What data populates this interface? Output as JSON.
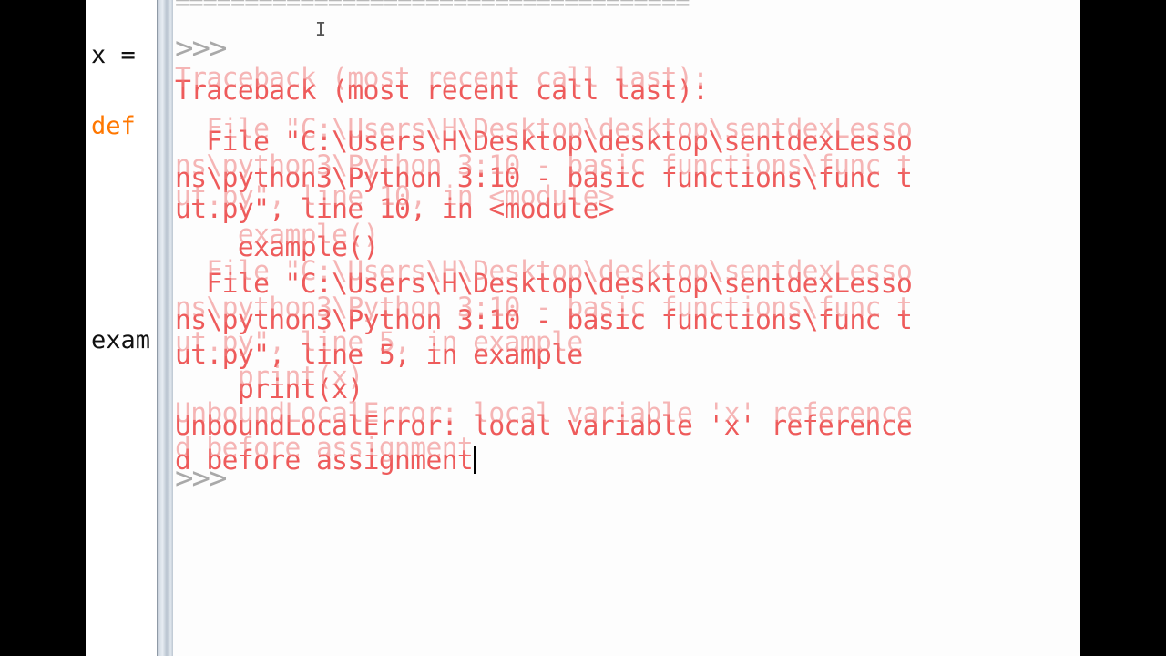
{
  "editor": {
    "lines": [
      {
        "text": "x = ",
        "color": "#111111"
      },
      {
        "text": "def ",
        "color": "#ff7700"
      },
      {
        "text": "exam",
        "color": "#111111"
      }
    ]
  },
  "shell": {
    "separator": "=====================================",
    "prompt": ">>>",
    "traceback": [
      "Traceback (most recent call last):",
      "  File \"C:\\Users\\H\\Desktop\\desktop\\sentdexLesso",
      "ns\\python3\\Python 3:10 - basic functions\\func t",
      "ut.py\", line 10, in <module>",
      "    example()",
      "  File \"C:\\Users\\H\\Desktop\\desktop\\sentdexLesso",
      "ns\\python3\\Python 3:10 - basic functions\\func t",
      "ut.py\", line 5, in example",
      "    print(x)",
      "UnboundLocalError: local variable 'x' reference",
      "d before assignment"
    ],
    "error_color": "#ee5b5b"
  }
}
